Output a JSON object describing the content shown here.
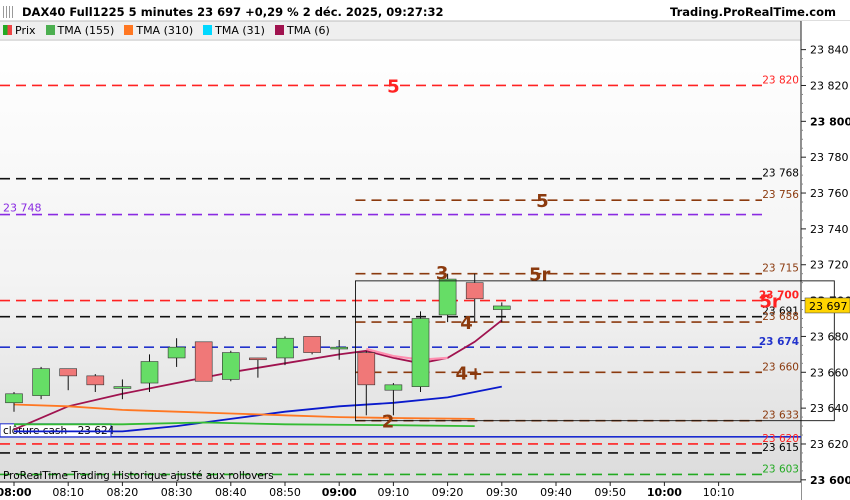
{
  "header": {
    "title": "DAX40 Full1225 5 minutes 23 697 +0,29 % 2 déc. 2025, 09:27:32",
    "site": "Trading.ProRealTime.com"
  },
  "legend": [
    {
      "label": "Prix",
      "color": "#22aa22",
      "swatch": "price"
    },
    {
      "label": "TMA (155)",
      "color": "#4caf50"
    },
    {
      "label": "TMA (310)",
      "color": "#ff7722"
    },
    {
      "label": "TMA (31)",
      "color": "#00d8ff"
    },
    {
      "label": "TMA (6)",
      "color": "#a0134f"
    }
  ],
  "footer": "ProRealTime Trading  Historique ajusté aux rollovers",
  "colors": {
    "up": "#66dd66",
    "down": "#f07878",
    "background_top": "#ffffff",
    "background_bottom": "#dcdcdc"
  },
  "chart_data": {
    "type": "candlestick",
    "instrument": "DAX40 Full1225",
    "timeframe": "5 minutes",
    "x_labels": [
      "08:00",
      "08:10",
      "08:20",
      "08:30",
      "08:40",
      "08:50",
      "09:00",
      "09:10",
      "09:20",
      "09:30",
      "09:40",
      "09:50",
      "10:00",
      "10:10"
    ],
    "x_label_bold": [
      "08:00",
      "09:00",
      "10:00"
    ],
    "y_labels": [
      23600,
      23620,
      23640,
      23660,
      23680,
      23700,
      23720,
      23740,
      23760,
      23780,
      23800,
      23820,
      23840
    ],
    "y_label_bold": [
      23600,
      23700,
      23800
    ],
    "y_range": [
      23597,
      23845
    ],
    "candles": [
      {
        "t": "08:00",
        "o": 23643,
        "h": 23649,
        "l": 23638,
        "c": 23648
      },
      {
        "t": "08:05",
        "o": 23647,
        "h": 23663,
        "l": 23645,
        "c": 23662
      },
      {
        "t": "08:10",
        "o": 23662,
        "h": 23662,
        "l": 23650,
        "c": 23658
      },
      {
        "t": "08:15",
        "o": 23658,
        "h": 23659,
        "l": 23649,
        "c": 23653
      },
      {
        "t": "08:20",
        "o": 23651,
        "h": 23656,
        "l": 23645,
        "c": 23652
      },
      {
        "t": "08:25",
        "o": 23654,
        "h": 23670,
        "l": 23649,
        "c": 23666
      },
      {
        "t": "08:30",
        "o": 23668,
        "h": 23679,
        "l": 23663,
        "c": 23674
      },
      {
        "t": "08:35",
        "o": 23677,
        "h": 23677,
        "l": 23655,
        "c": 23655
      },
      {
        "t": "08:40",
        "o": 23656,
        "h": 23672,
        "l": 23655,
        "c": 23671
      },
      {
        "t": "08:45",
        "o": 23668,
        "h": 23668,
        "l": 23657,
        "c": 23667
      },
      {
        "t": "08:50",
        "o": 23668,
        "h": 23680,
        "l": 23664,
        "c": 23679
      },
      {
        "t": "08:55",
        "o": 23680,
        "h": 23680,
        "l": 23670,
        "c": 23671
      },
      {
        "t": "09:00",
        "o": 23673,
        "h": 23678,
        "l": 23667,
        "c": 23674
      },
      {
        "t": "09:05",
        "o": 23671,
        "h": 23672,
        "l": 23636,
        "c": 23653
      },
      {
        "t": "09:10",
        "o": 23650,
        "h": 23654,
        "l": 23636,
        "c": 23653
      },
      {
        "t": "09:15",
        "o": 23652,
        "h": 23694,
        "l": 23649,
        "c": 23690
      },
      {
        "t": "09:20",
        "o": 23692,
        "h": 23715,
        "l": 23688,
        "c": 23712
      },
      {
        "t": "09:25",
        "o": 23710,
        "h": 23715,
        "l": 23688,
        "c": 23701
      },
      {
        "t": "09:30",
        "o": 23695,
        "h": 23699,
        "l": 23688,
        "c": 23697
      }
    ],
    "series": [
      {
        "name": "TMA (6)",
        "color": "#a0134f",
        "points": [
          [
            0,
            23628
          ],
          [
            2,
            23641
          ],
          [
            4,
            23648
          ],
          [
            6,
            23654
          ],
          [
            8,
            23660
          ],
          [
            10,
            23665
          ],
          [
            12,
            23670
          ],
          [
            13,
            23672
          ],
          [
            14,
            23668
          ],
          [
            15,
            23665
          ],
          [
            16,
            23668
          ],
          [
            17,
            23677
          ],
          [
            18,
            23689
          ]
        ]
      },
      {
        "name": "TMA (31)",
        "color": "#0a1acc",
        "points": [
          [
            0,
            23627
          ],
          [
            4,
            23627
          ],
          [
            6,
            23630
          ],
          [
            8,
            23634
          ],
          [
            10,
            23638
          ],
          [
            12,
            23641
          ],
          [
            14,
            23643
          ],
          [
            16,
            23646
          ],
          [
            18,
            23652
          ]
        ]
      },
      {
        "name": "TMA (310)",
        "color": "#ff7722",
        "points": [
          [
            0,
            23642
          ],
          [
            2,
            23641
          ],
          [
            4,
            23639
          ],
          [
            6,
            23638
          ],
          [
            8,
            23637
          ],
          [
            10,
            23636
          ],
          [
            12,
            23635
          ],
          [
            14,
            23634.5
          ],
          [
            17,
            23634
          ]
        ]
      },
      {
        "name": "TMA (155)",
        "color": "#33bb33",
        "points": [
          [
            0,
            23631
          ],
          [
            4,
            23631
          ],
          [
            7,
            23632
          ],
          [
            10,
            23631
          ],
          [
            14,
            23630.5
          ],
          [
            17,
            23630
          ]
        ]
      },
      {
        "name": "TMA (6) pink",
        "color": "#ff8fb0",
        "points": [
          [
            13,
            23673
          ],
          [
            14,
            23669
          ],
          [
            15,
            23667
          ],
          [
            16,
            23668
          ]
        ]
      }
    ],
    "levels": [
      {
        "value": 23820,
        "label": "23 820",
        "color": "#ff2222",
        "style": "dashed"
      },
      {
        "value": 23768,
        "label": "23 768",
        "color": "#111111",
        "style": "dashed"
      },
      {
        "value": 23756,
        "label": "23 756",
        "color": "#8b3a0e",
        "style": "dashed",
        "partial": true
      },
      {
        "value": 23748,
        "label": "23 748",
        "color": "#8a2be2",
        "style": "dashed",
        "label_side": "left"
      },
      {
        "value": 23715,
        "label": "23 715",
        "color": "#8b3a0e",
        "style": "dashed",
        "partial": true
      },
      {
        "value": 23700,
        "label": "23 700",
        "color": "#ff2222",
        "style": "dashed",
        "bold": true
      },
      {
        "value": 23691,
        "label": "23 691",
        "color": "#111111",
        "style": "dashed"
      },
      {
        "value": 23688,
        "label": "23 688",
        "color": "#8b3a0e",
        "style": "dashed",
        "partial": true
      },
      {
        "value": 23674,
        "label": "23 674",
        "color": "#2233cc",
        "style": "dashed",
        "bold": true
      },
      {
        "value": 23660,
        "label": "23 660",
        "color": "#8b3a0e",
        "style": "dashed",
        "partial": true
      },
      {
        "value": 23633,
        "label": "23 633",
        "color": "#8b3a0e",
        "style": "dashed",
        "partial": true
      },
      {
        "value": 23624,
        "label": "clôture cash - 23 624",
        "color": "#1a2ad0",
        "style": "solid",
        "label_side": "left-box"
      },
      {
        "value": 23620,
        "label": "23 620",
        "color": "#ff2222",
        "style": "dashed"
      },
      {
        "value": 23615,
        "label": "23 615",
        "color": "#111111",
        "style": "dashed"
      },
      {
        "value": 23603,
        "label": "23 603",
        "color": "#22aa22",
        "style": "dashed"
      }
    ],
    "annotations": [
      {
        "text": "5",
        "t_index": 14.0,
        "value": 23820,
        "color": "#ff2222"
      },
      {
        "text": "5",
        "t_index": 19.5,
        "value": 23756,
        "color": "#8b3a0e"
      },
      {
        "text": "3",
        "t_index": 15.8,
        "value": 23716,
        "color": "#8b3a0e"
      },
      {
        "text": "5r",
        "t_index": 19.4,
        "value": 23715,
        "color": "#8b3a0e"
      },
      {
        "text": "5r",
        "t_index": 27.9,
        "value": 23700,
        "color": "#ff2222"
      },
      {
        "text": "4",
        "t_index": 16.7,
        "value": 23688,
        "color": "#8b3a0e"
      },
      {
        "text": "4+",
        "t_index": 16.8,
        "value": 23660,
        "color": "#8b3a0e"
      },
      {
        "text": "2",
        "t_index": 13.8,
        "value": 23633,
        "color": "#8b3a0e"
      }
    ],
    "last_price": {
      "value": 23697,
      "label": "23 697"
    },
    "box": {
      "t_start": 12.6,
      "t_end": 19.2,
      "top": 23711,
      "bottom": 23633
    }
  }
}
